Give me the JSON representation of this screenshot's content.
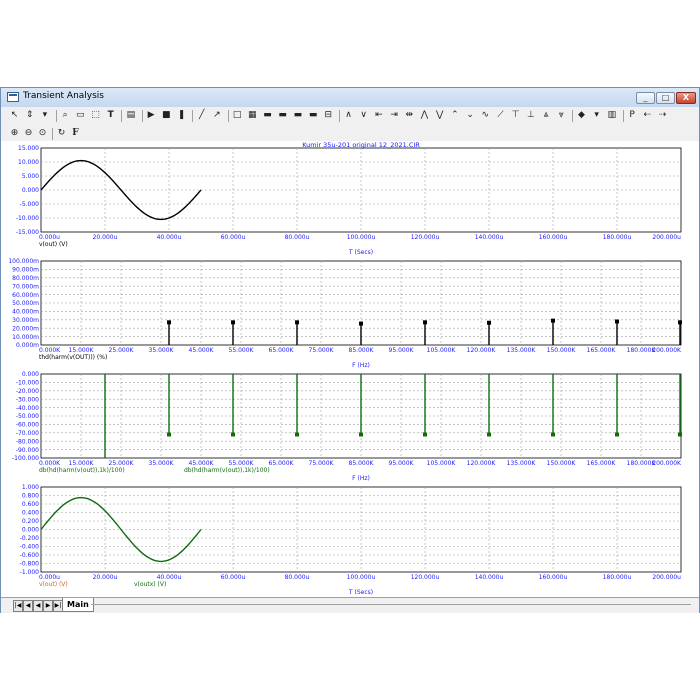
{
  "window": {
    "title": "Transient Analysis",
    "minimize": "_",
    "maximize": "□",
    "close": "X"
  },
  "toolbar": {
    "row1": [
      "cursor-arrow-icon",
      "scale-icon",
      "dropdown-icon",
      "zoom-region-icon",
      "zoom-box-icon",
      "zoom-select-icon",
      "text-icon",
      "properties-icon",
      "run-icon",
      "stop-icon",
      "pause-icon",
      "line-tool-icon",
      "arrow-tool-icon",
      "frame-icon",
      "grid-icon",
      "layout-1-icon",
      "layout-2-icon",
      "layout-3-icon",
      "layout-4-icon",
      "split-icon",
      "peak-icon",
      "valley-icon",
      "cursor-left-icon",
      "cursor-right-icon",
      "measure-icon",
      "next-peak-icon",
      "next-valley-icon",
      "high-icon",
      "low-icon",
      "inflection-icon",
      "slope-icon",
      "top-icon",
      "bottom-icon",
      "global-high-icon",
      "global-low-icon",
      "tag-icon",
      "dropdown-icon",
      "table-icon",
      "probe-p-icon",
      "tag-left-icon",
      "tag-right-icon"
    ],
    "row2": [
      "zoom-in-icon",
      "zoom-out-icon",
      "zoom-fit-icon",
      "refresh-icon",
      "font-icon"
    ],
    "text_label": "T",
    "font_label": "F"
  },
  "tabs": {
    "main": "Main"
  },
  "colors": {
    "black_trace": "#000000",
    "green_trace": "#0e6b0e",
    "axis_text": "#1a1aff",
    "grid": "#a0a0a0"
  },
  "chart_data": [
    {
      "type": "line",
      "title": "Kumir 35u-201 original 12_2021.CIR",
      "xlabel": "T (Secs)",
      "legend": [
        "v(out) (V)"
      ],
      "xlim": [
        0,
        200
      ],
      "ylim": [
        -15,
        15
      ],
      "xticks": [
        "0.000u",
        "20.000u",
        "40.000u",
        "60.000u",
        "80.000u",
        "100.000u",
        "120.000u",
        "140.000u",
        "160.000u",
        "180.000u",
        "200.000u"
      ],
      "yticks": [
        "15.000",
        "10.000",
        "5.000",
        "0.000",
        "-5.000",
        "-10.000",
        "-15.000"
      ],
      "series": [
        {
          "name": "v(out) (V)",
          "color": "#000000",
          "func": "sine",
          "amplitude": 10.5,
          "period": 50,
          "x_end": 50
        }
      ]
    },
    {
      "type": "bar",
      "xlabel": "F (Hz)",
      "legend": [
        "thd(harm(v(OUT))) (%)"
      ],
      "xlim": [
        0,
        200000
      ],
      "ylim": [
        0,
        100
      ],
      "xticks": [
        "0.000K",
        "15.000K",
        "25.000K",
        "35.000K",
        "45.000K",
        "55.000K",
        "65.000K",
        "75.000K",
        "85.000K",
        "95.000K",
        "105.000K",
        "120.000K",
        "135.000K",
        "150.000K",
        "165.000K",
        "180.000K",
        "200.000K"
      ],
      "yticks": [
        "100.000m",
        "90.000m",
        "80.000m",
        "70.000m",
        "60.000m",
        "50.000m",
        "40.000m",
        "30.000m",
        "20.000m",
        "10.000m",
        "0.000m"
      ],
      "series": [
        {
          "name": "thd(harm(v(OUT))) (%)",
          "color": "#000000",
          "x": [
            20000,
            40000,
            60000,
            80000,
            100000,
            120000,
            140000,
            160000,
            180000,
            200000
          ],
          "values": [
            0,
            27,
            27,
            27,
            25.5,
            27,
            26.5,
            29,
            28,
            27
          ]
        }
      ]
    },
    {
      "type": "bar",
      "xlabel": "F (Hz)",
      "legend": [
        "db(hd(harm(v(out)),1k)/100)",
        "db(hd(harm(v(out)),1k)/100)"
      ],
      "xlim": [
        0,
        200000
      ],
      "ylim": [
        -100,
        0
      ],
      "xticks": [
        "0.000K",
        "15.000K",
        "25.000K",
        "35.000K",
        "45.000K",
        "55.000K",
        "65.000K",
        "75.000K",
        "85.000K",
        "95.000K",
        "105.000K",
        "120.000K",
        "135.000K",
        "150.000K",
        "165.000K",
        "180.000K",
        "200.000K"
      ],
      "yticks": [
        "0.000",
        "-10.000",
        "-20.000",
        "-30.000",
        "-40.000",
        "-50.000",
        "-60.000",
        "-70.000",
        "-80.000",
        "-90.000",
        "-100.000"
      ],
      "series": [
        {
          "name": "db(hd(harm(v(out)),1k)/100)",
          "color": "#0e6b0e",
          "x": [
            20000,
            40000,
            60000,
            80000,
            100000,
            120000,
            140000,
            160000,
            180000,
            200000
          ],
          "values": [
            -100,
            -72,
            -72,
            -72,
            -72,
            -72,
            -72,
            -72,
            -72,
            -72
          ]
        }
      ]
    },
    {
      "type": "line",
      "xlabel": "T (Secs)",
      "legend": [
        "v(out) (V)",
        "v(outx) (V)"
      ],
      "xlim": [
        0,
        200
      ],
      "ylim": [
        -1,
        1
      ],
      "xticks": [
        "0.000u",
        "20.000u",
        "40.000u",
        "60.000u",
        "80.000u",
        "100.000u",
        "120.000u",
        "140.000u",
        "160.000u",
        "180.000u",
        "200.000u"
      ],
      "yticks": [
        "1.000",
        "0.800",
        "0.600",
        "0.400",
        "0.200",
        "0.000",
        "-0.200",
        "-0.400",
        "-0.600",
        "-0.800",
        "-1.000"
      ],
      "series": [
        {
          "name": "v(outx) (V)",
          "color": "#0e6b0e",
          "func": "sine",
          "amplitude": 0.75,
          "period": 50,
          "x_end": 50
        }
      ]
    }
  ]
}
